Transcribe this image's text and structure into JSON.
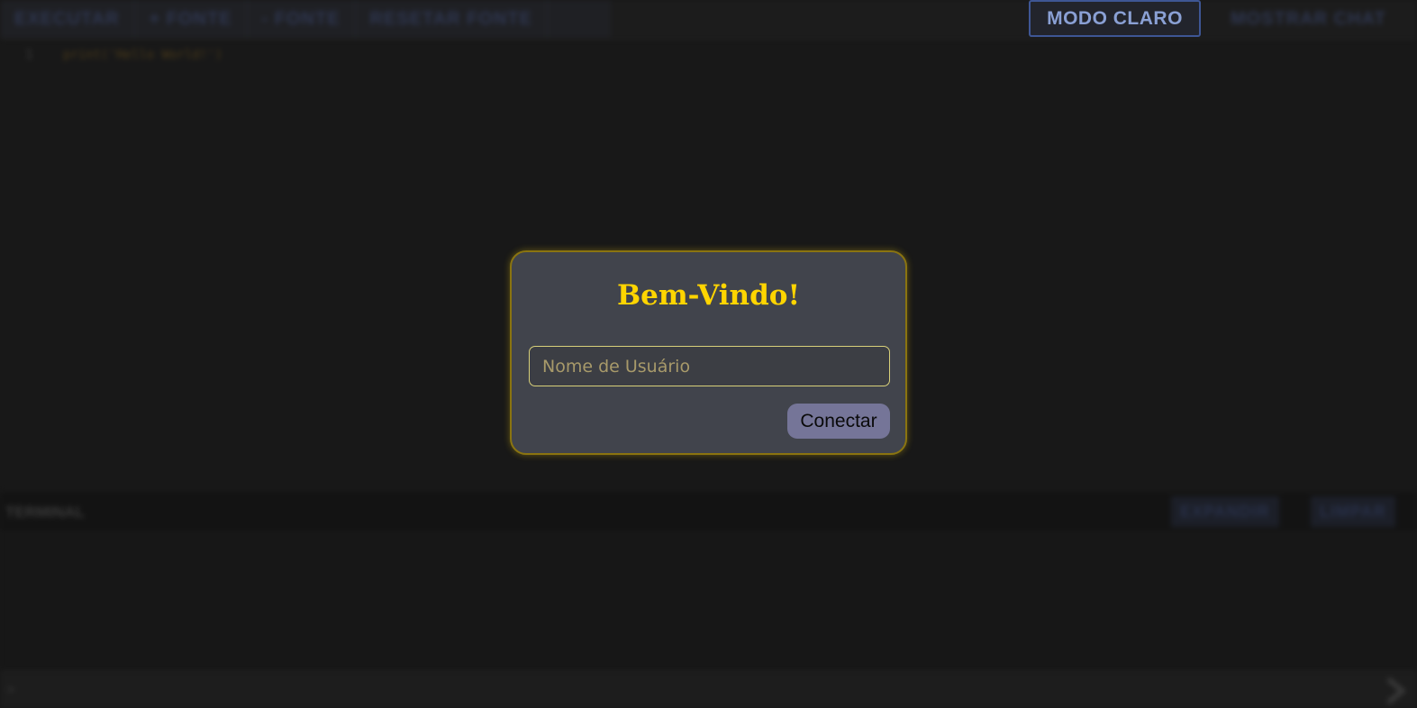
{
  "toolbar": {
    "items": [
      {
        "label": "EXECUTAR"
      },
      {
        "label": "+ FONTE"
      },
      {
        "label": "- FONTE"
      },
      {
        "label": "RESETAR FONTE"
      }
    ],
    "mode_button": "MODO CLARO",
    "chat_button": "MOSTRAR CHAT"
  },
  "editor": {
    "line_number": "1",
    "code": "print('Hello World!')"
  },
  "terminal": {
    "title": "TERMINAL",
    "expand_button": "EXPANDIR",
    "clear_button": "LIMPAR"
  },
  "input_bar": {
    "prompt": ">",
    "send_icon": "chevron-right-icon"
  },
  "modal": {
    "title": "Bem-Vindo!",
    "username_placeholder": "Nome de Usuário",
    "username_value": "",
    "connect_button": "Conectar"
  },
  "colors": {
    "accent": "#ffd500",
    "modal_bg": "#41444c",
    "button_bg": "#757598",
    "mode_border": "#3e5694"
  }
}
